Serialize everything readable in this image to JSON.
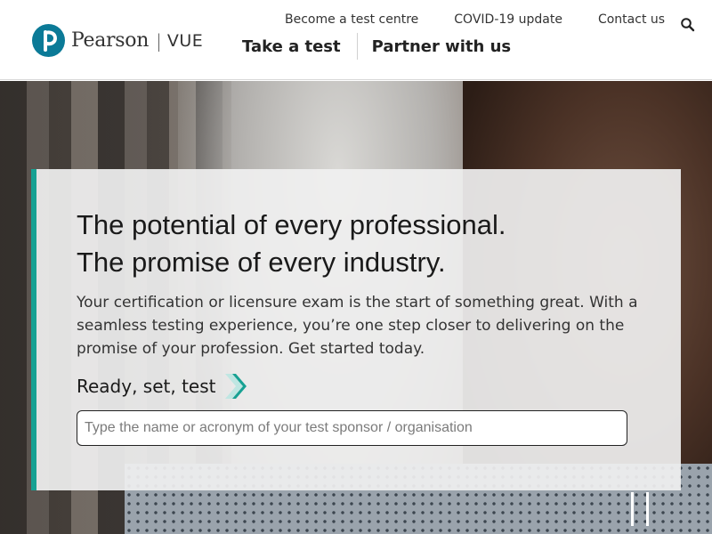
{
  "brand": {
    "name": "Pearson",
    "product": "VUE"
  },
  "utility_nav": [
    {
      "label": "Become a test centre"
    },
    {
      "label": "COVID-19 update"
    },
    {
      "label": "Contact us"
    }
  ],
  "main_nav": [
    {
      "label": "Take a test"
    },
    {
      "label": "Partner with us"
    }
  ],
  "search": {
    "icon": "search-icon"
  },
  "hero": {
    "headline_line1": "The potential of every professional.",
    "headline_line2": "The promise of every industry.",
    "intro": "Your certification or licensure exam is the start of something great. With a seamless testing experience, you’re one step closer to delivering on the promise of your profession. Get started today.",
    "cta_label": "Ready, set, test",
    "sponsor_search": {
      "value": "",
      "placeholder": "Type the name or acronym of your test sponsor / organisation"
    },
    "pause_icon": "pause-icon"
  },
  "colors": {
    "brand_blue": "#0b7a97",
    "accent_teal": "#17a193"
  }
}
